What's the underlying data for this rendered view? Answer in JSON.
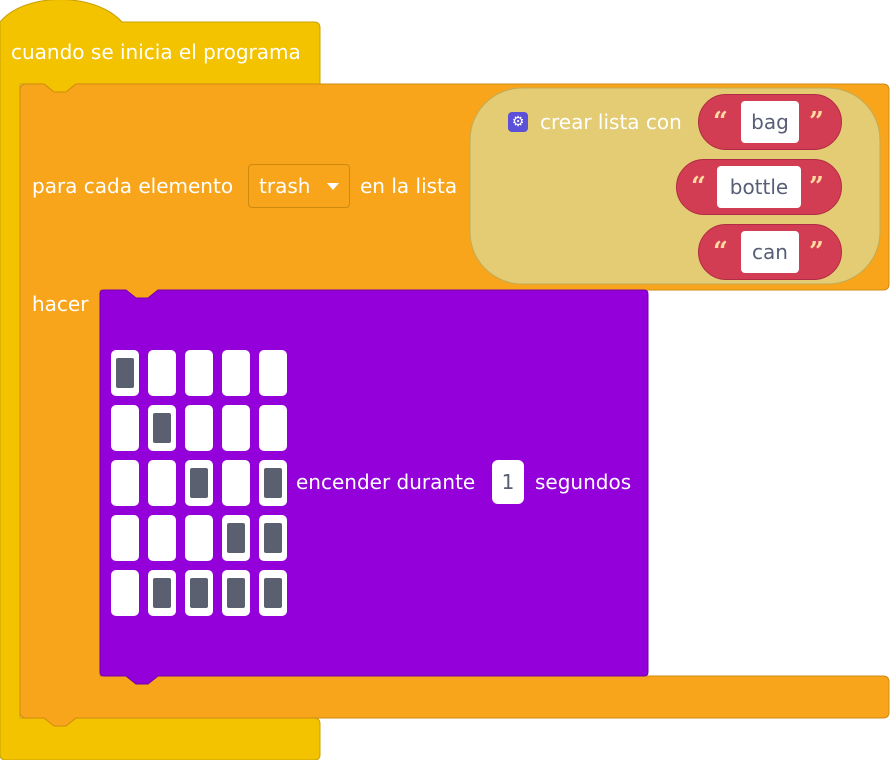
{
  "event_block": {
    "label": "cuando se inicia el programa"
  },
  "foreach_block": {
    "label_before": "para cada elemento",
    "variable": "trash",
    "label_after": "en la lista",
    "do_label": "hacer"
  },
  "list_block": {
    "label": "crear lista con",
    "gear_icon": "gear-icon",
    "items": [
      "bag",
      "bottle",
      "can"
    ],
    "open_quote": "“",
    "close_quote": "”"
  },
  "led_block": {
    "grid": [
      [
        1,
        0,
        0,
        0,
        0
      ],
      [
        0,
        1,
        0,
        0,
        0
      ],
      [
        0,
        0,
        1,
        0,
        1
      ],
      [
        0,
        0,
        0,
        1,
        1
      ],
      [
        0,
        1,
        1,
        1,
        1
      ]
    ],
    "label_before": "encender durante",
    "duration": "1",
    "label_after": "segundos"
  },
  "colors": {
    "event": "#f3c300",
    "loop": "#f9a51b",
    "list": "#e3cc73",
    "string": "#d23d54",
    "led": "#9400d9",
    "gear": "#5c4fd8"
  }
}
